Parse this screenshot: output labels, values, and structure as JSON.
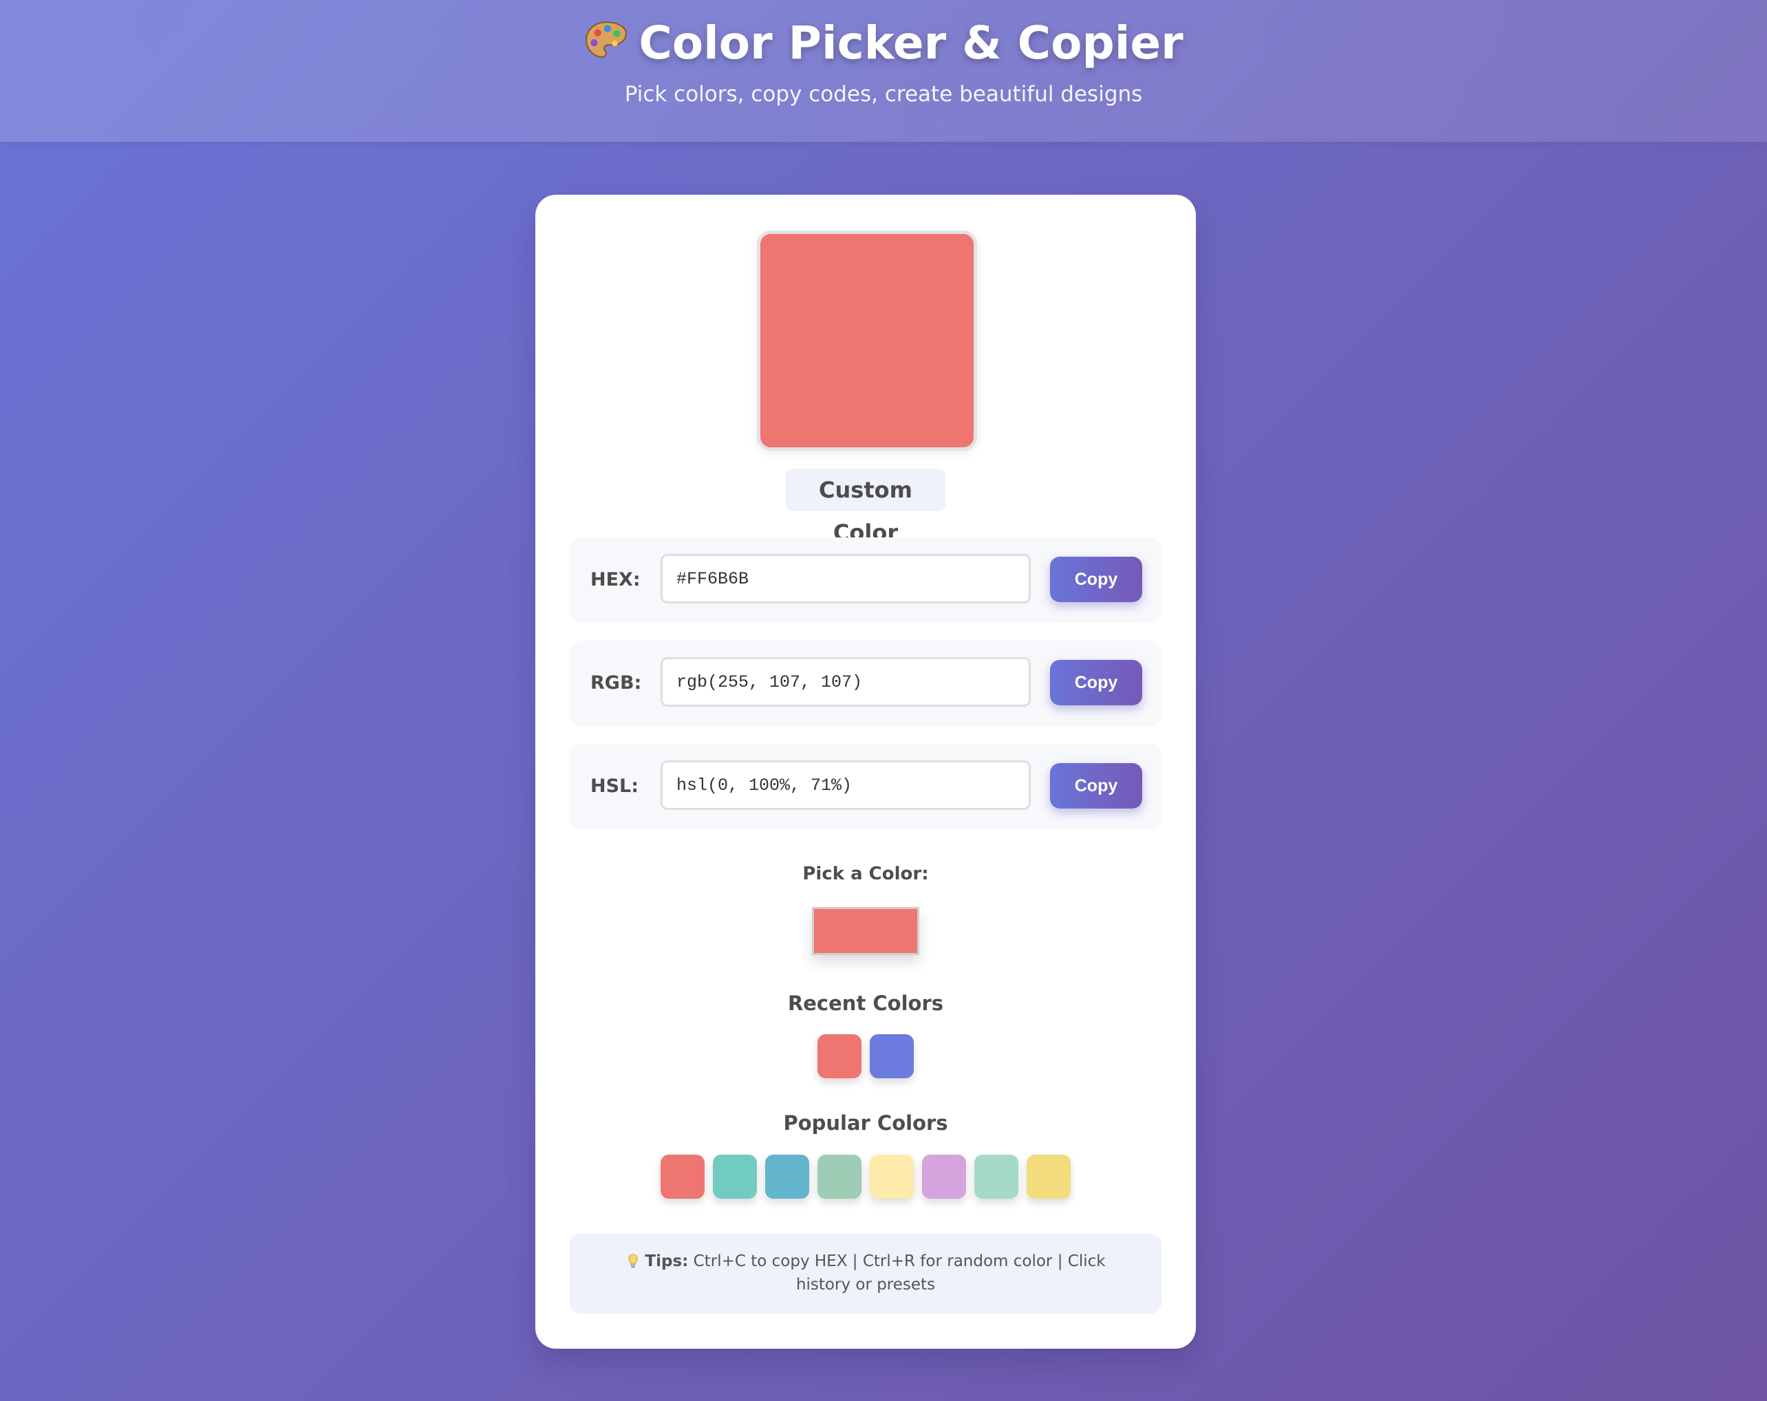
{
  "header": {
    "title": "Color Picker & Copier",
    "subtitle": "Pick colors, copy codes, create beautiful designs",
    "icon": "palette-icon"
  },
  "preview": {
    "color": "#ef7571",
    "name": "Custom Color"
  },
  "formats": [
    {
      "label": "HEX:",
      "value": "#FF6B6B",
      "button": "Copy"
    },
    {
      "label": "RGB:",
      "value": "rgb(255, 107, 107)",
      "button": "Copy"
    },
    {
      "label": "HSL:",
      "value": "hsl(0, 100%, 71%)",
      "button": "Copy"
    }
  ],
  "picker": {
    "label": "Pick a Color:",
    "color": "#ef7571"
  },
  "recent": {
    "title": "Recent Colors",
    "colors": [
      "#ef7571",
      "#6b7cde"
    ]
  },
  "popular": {
    "title": "Popular Colors",
    "colors": [
      "#ef7571",
      "#72cbc1",
      "#63b4cd",
      "#9dcdb4",
      "#fcebaa",
      "#d5a3dd",
      "#a5d9c9",
      "#f3dc7b"
    ]
  },
  "tips": {
    "icon": "lightbulb-icon",
    "label": "Tips:",
    "text": "Ctrl+C to copy HEX | Ctrl+R for random color | Click history or presets"
  },
  "colors": {
    "accent_start": "#6875d8",
    "accent_end": "#7659b8",
    "background_start": "#6a74d6",
    "background_end": "#6f54a4"
  }
}
